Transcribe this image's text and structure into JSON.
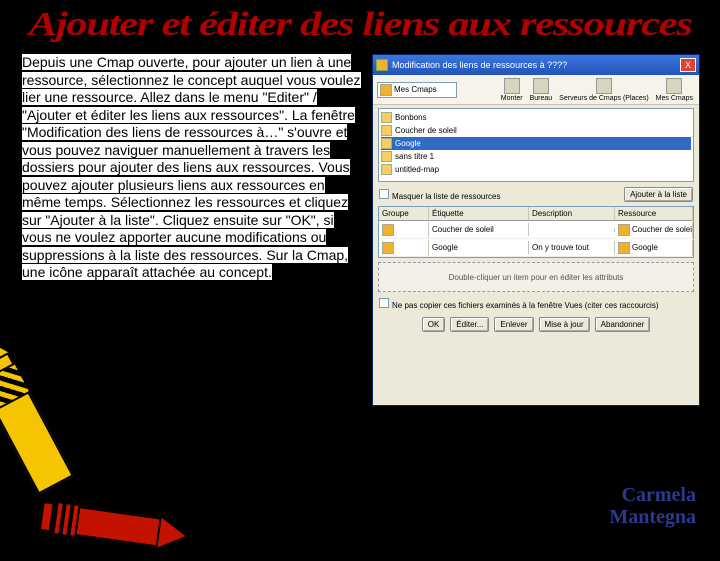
{
  "title": "Ajouter et éditer des liens aux ressources",
  "paragraph": "Depuis une Cmap ouverte, pour ajouter un lien à une ressource, sélectionnez le concept auquel vous voulez lier une ressource. Allez dans le menu \"Editer\" / \"Ajouter et éditer les liens aux ressources\". La fenêtre \"Modification des liens de ressources à…\" s'ouvre et vous pouvez naviguer manuellement à travers les dossiers pour ajouter des liens aux ressources. Vous pouvez ajouter plusieurs liens aux ressources en même temps. Sélectionnez les ressources et cliquez sur \"Ajouter à la liste\". Cliquez ensuite sur \"OK\", si vous ne voulez apporter aucune modifications ou suppressions à la liste des ressources. Sur la Cmap, une icône apparaît attachée au concept.",
  "author": "Carmela Mantegna",
  "window": {
    "title": "Modification des liens de ressources à ????",
    "close": "X",
    "address_label": "Mes Cmaps",
    "nav": {
      "b1": "Monter",
      "b2": "Bureau",
      "b3": "Serveurs de Cmaps (Places)",
      "b4": "Mes Cmaps"
    },
    "tree": {
      "items": [
        {
          "label": "Bonbons"
        },
        {
          "label": "Coucher de soleil"
        },
        {
          "label": "Google",
          "selected": true
        },
        {
          "label": "sans titre 1"
        },
        {
          "label": "untitled-map"
        }
      ]
    },
    "mask_label": "Masquer la liste de ressources",
    "add_button": "Ajouter à la liste",
    "table": {
      "headers": [
        "Groupe",
        "Étiquette",
        "Description",
        "Ressource"
      ],
      "rows": [
        {
          "etiquette": "Coucher de soleil",
          "description": "",
          "resource": "Coucher de soleil"
        },
        {
          "etiquette": "Google",
          "description": "On y trouve tout",
          "resource": "Google"
        }
      ]
    },
    "drop_hint": "Double-cliquer un item pour en éditer les attributs",
    "copy_label": "Ne pas copier ces fichiers examinés à la fenêtre Vues (citer ces raccourcis)",
    "buttons": {
      "ok": "OK",
      "edit": "Éditer...",
      "delete": "Enlever",
      "update": "Mise à jour",
      "cancel": "Abandonner"
    }
  }
}
